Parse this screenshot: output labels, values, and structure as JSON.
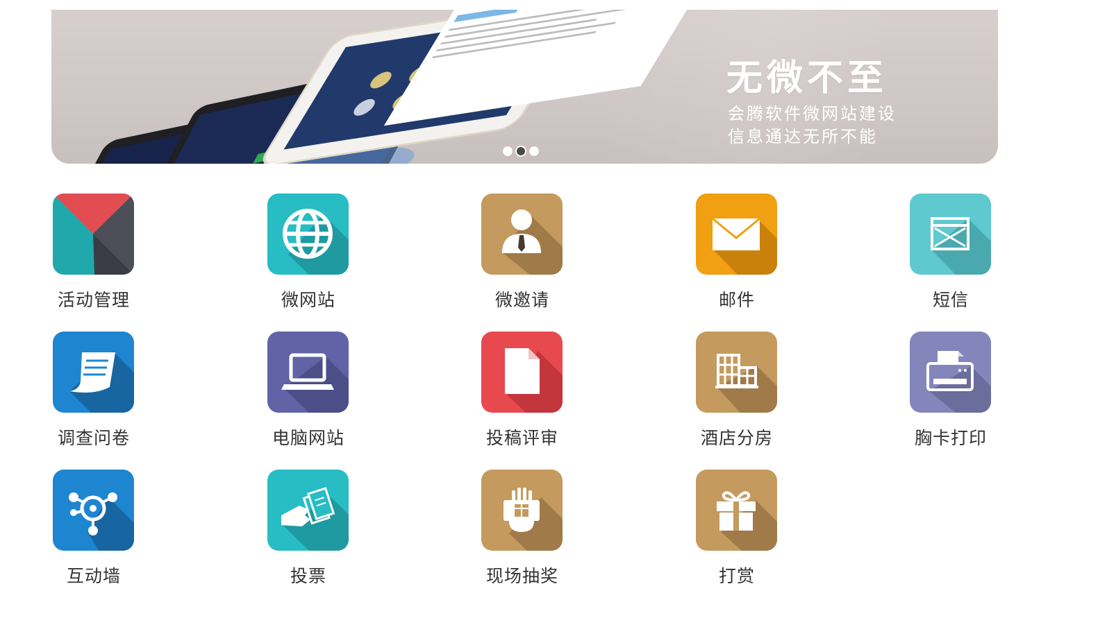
{
  "banner": {
    "title": "无微不至",
    "subtitle_line1": "会腾软件微网站建设",
    "subtitle_line2": "信息通达无所不能",
    "slides": 3,
    "active_slide": 2
  },
  "modules": [
    {
      "label": "活动管理",
      "icon": "activity-management-icon",
      "color": "#20a9ad"
    },
    {
      "label": "微网站",
      "icon": "globe-icon",
      "color": "#28bcc4"
    },
    {
      "label": "微邀请",
      "icon": "person-icon",
      "color": "#c49a5e"
    },
    {
      "label": "邮件",
      "icon": "envelope-icon",
      "color": "#f0a011"
    },
    {
      "label": "短信",
      "icon": "message-icon",
      "color": "#5ec9cf"
    },
    {
      "label": "调查问卷",
      "icon": "survey-icon",
      "color": "#1e86d0"
    },
    {
      "label": "电脑网站",
      "icon": "laptop-icon",
      "color": "#6163a7"
    },
    {
      "label": "投稿评审",
      "icon": "document-icon",
      "color": "#e8494f"
    },
    {
      "label": "酒店分房",
      "icon": "hotel-icon",
      "color": "#c49a5e"
    },
    {
      "label": "胸卡打印",
      "icon": "printer-icon",
      "color": "#8486bb"
    },
    {
      "label": "互动墙",
      "icon": "network-icon",
      "color": "#1e86d0"
    },
    {
      "label": "投票",
      "icon": "vote-icon",
      "color": "#28bcc4"
    },
    {
      "label": "现场抽奖",
      "icon": "lottery-icon",
      "color": "#c49a5e"
    },
    {
      "label": "打赏",
      "icon": "gift-icon",
      "color": "#c49a5e"
    }
  ]
}
